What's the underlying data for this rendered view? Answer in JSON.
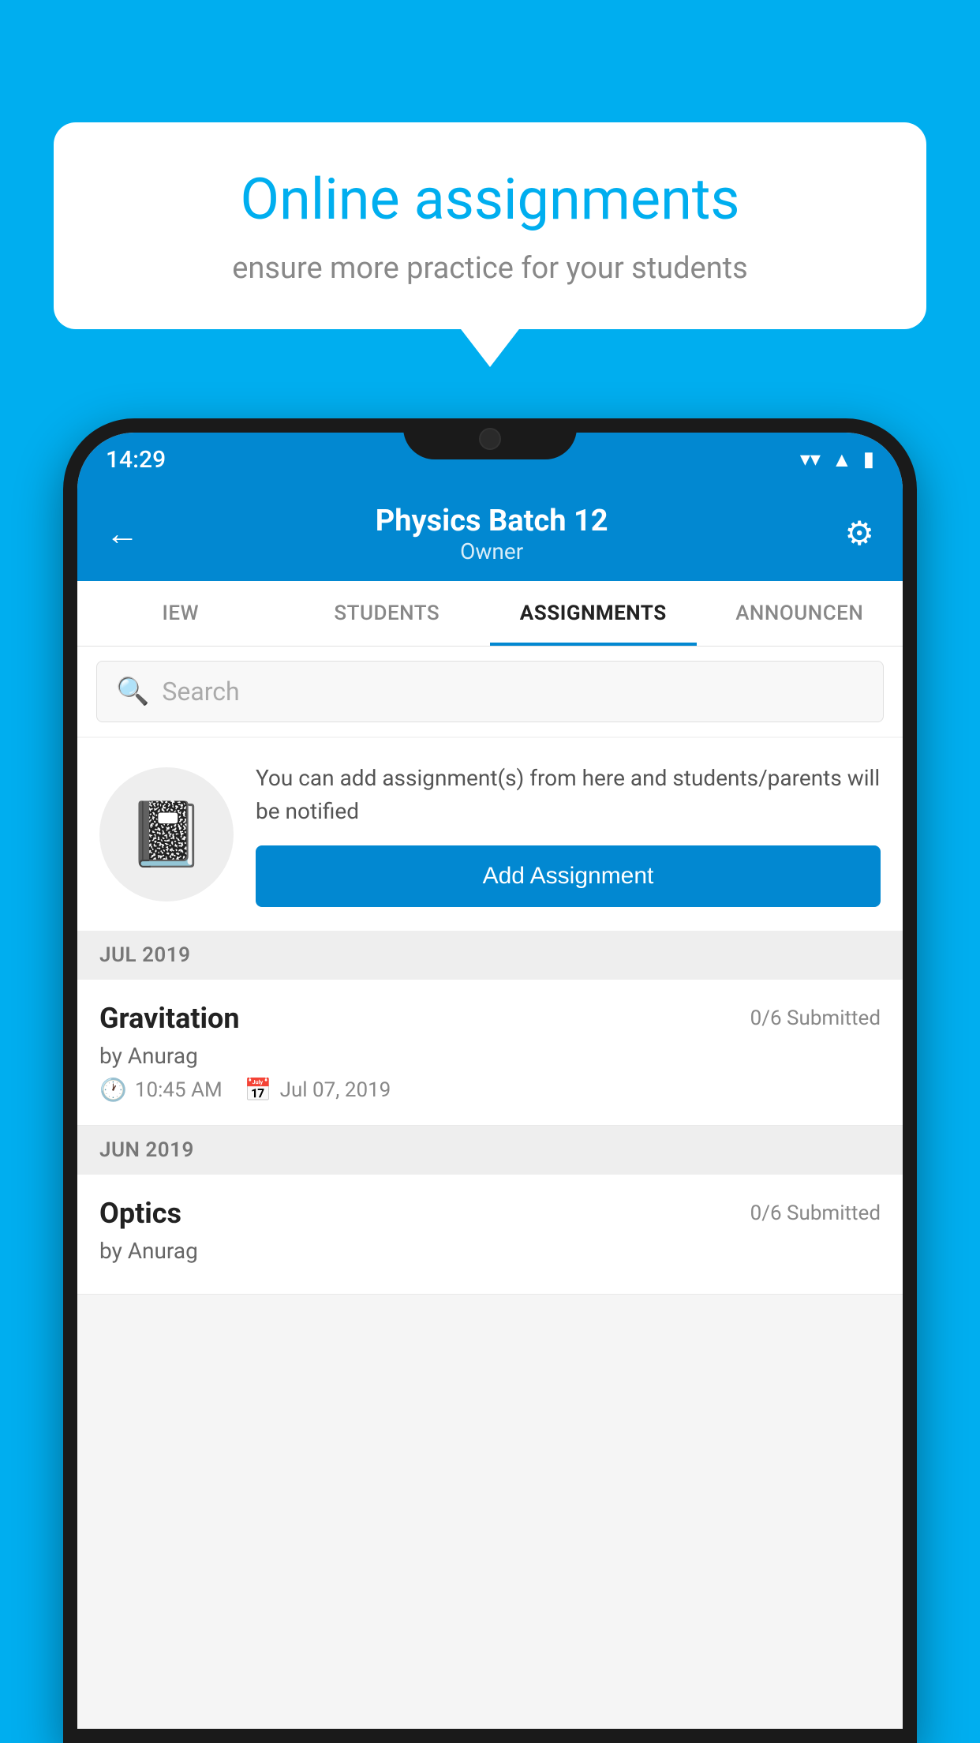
{
  "background_color": "#00AEEF",
  "speech_bubble": {
    "title": "Online assignments",
    "subtitle": "ensure more practice for your students"
  },
  "status_bar": {
    "time": "14:29",
    "wifi_icon": "▾",
    "signal_icon": "◀",
    "battery_icon": "▮"
  },
  "header": {
    "title": "Physics Batch 12",
    "subtitle": "Owner",
    "back_label": "←",
    "settings_icon": "⚙"
  },
  "tabs": [
    {
      "id": "overview",
      "label": "IEW",
      "active": false
    },
    {
      "id": "students",
      "label": "STUDENTS",
      "active": false
    },
    {
      "id": "assignments",
      "label": "ASSIGNMENTS",
      "active": true
    },
    {
      "id": "announcements",
      "label": "ANNOUNCEN",
      "active": false
    }
  ],
  "search": {
    "placeholder": "Search",
    "icon": "🔍"
  },
  "promo": {
    "description": "You can add assignment(s) from here and students/parents will be notified",
    "button_label": "Add Assignment",
    "icon": "📓"
  },
  "sections": [
    {
      "label": "JUL 2019",
      "assignments": [
        {
          "name": "Gravitation",
          "submitted": "0/6 Submitted",
          "author": "by Anurag",
          "time": "10:45 AM",
          "date": "Jul 07, 2019"
        }
      ]
    },
    {
      "label": "JUN 2019",
      "assignments": [
        {
          "name": "Optics",
          "submitted": "0/6 Submitted",
          "author": "by Anurag",
          "time": "",
          "date": ""
        }
      ]
    }
  ]
}
